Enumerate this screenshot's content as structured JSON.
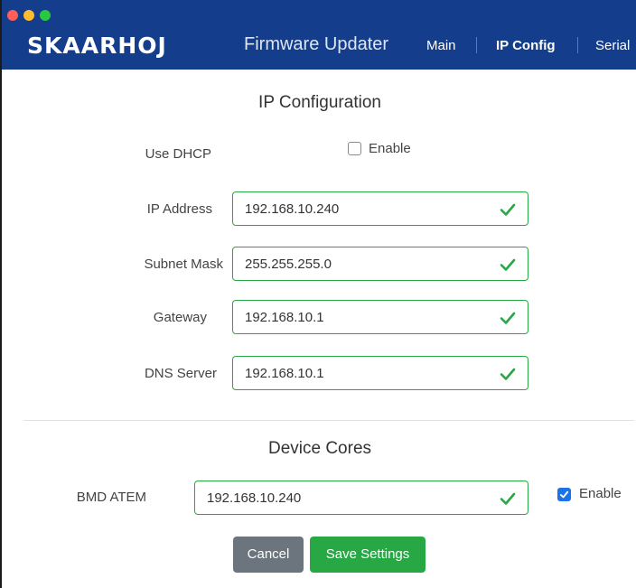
{
  "header": {
    "logo": "SKAARHOJ",
    "app_title": "Firmware Updater",
    "nav": [
      {
        "label": "Main",
        "active": false
      },
      {
        "label": "IP Config",
        "active": true
      },
      {
        "label": "Serial",
        "active": false
      }
    ]
  },
  "ip_config": {
    "title": "IP Configuration",
    "dhcp": {
      "label": "Use DHCP",
      "checkbox_label": "Enable",
      "checked": false
    },
    "fields": [
      {
        "label": "IP Address",
        "value": "192.168.10.240",
        "status": "valid"
      },
      {
        "label": "Subnet Mask",
        "value": "255.255.255.0",
        "status": "valid"
      },
      {
        "label": "Gateway",
        "value": "192.168.10.1",
        "status": "valid"
      },
      {
        "label": "DNS Server",
        "value": "192.168.10.1",
        "status": "valid"
      }
    ]
  },
  "device_cores": {
    "title": "Device Cores",
    "items": [
      {
        "label": "BMD ATEM",
        "value": "192.168.10.240",
        "status": "valid",
        "enable_label": "Enable",
        "enabled": true
      }
    ]
  },
  "actions": {
    "cancel_label": "Cancel",
    "save_label": "Save Settings"
  },
  "colors": {
    "header_bg": "#143d8b",
    "valid": "#28a745",
    "cancel": "#6c757d",
    "checkbox": "#1a73e8"
  },
  "icons": {
    "valid": "check-icon",
    "checkbox_checked": "checkmark-icon"
  }
}
